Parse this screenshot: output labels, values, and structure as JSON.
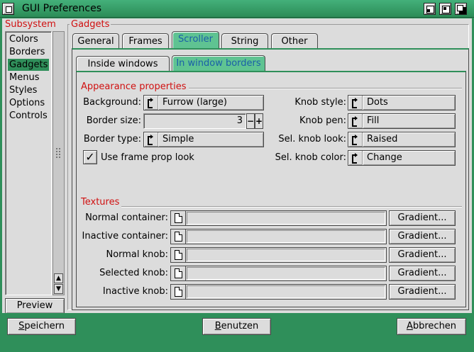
{
  "window": {
    "title": "GUI Preferences"
  },
  "subsystem": {
    "label": "Subsystem",
    "items": [
      "Colors",
      "Borders",
      "Gadgets",
      "Menus",
      "Styles",
      "Options",
      "Controls"
    ],
    "selected": "Gadgets",
    "preview_label": "Preview"
  },
  "gadgets": {
    "label": "Gadgets",
    "tabs": [
      "General",
      "Frames",
      "Scroller",
      "String",
      "Other"
    ],
    "active_tab": "Scroller",
    "subtabs": [
      "Inside windows",
      "In window borders"
    ],
    "active_subtab": "In window borders"
  },
  "appearance": {
    "title": "Appearance properties",
    "background_label": "Background:",
    "background_value": "Furrow (large)",
    "border_size_label": "Border size:",
    "border_size_value": "3",
    "minus": "−",
    "plus": "+",
    "border_type_label": "Border type:",
    "border_type_value": "Simple",
    "frame_prop_label": "Use frame prop look",
    "frame_prop_checked": "✓",
    "knob_style_label": "Knob style:",
    "knob_style_value": "Dots",
    "knob_pen_label": "Knob pen:",
    "knob_pen_value": "Fill",
    "sel_knob_look_label": "Sel. knob look:",
    "sel_knob_look_value": "Raised",
    "sel_knob_color_label": "Sel. knob color:",
    "sel_knob_color_value": "Change"
  },
  "textures": {
    "title": "Textures",
    "rows": [
      {
        "label": "Normal container:",
        "button": "Gradient..."
      },
      {
        "label": "Inactive container:",
        "button": "Gradient..."
      },
      {
        "label": "Normal knob:",
        "button": "Gradient..."
      },
      {
        "label": "Selected knob:",
        "button": "Gradient..."
      },
      {
        "label": "Inactive knob:",
        "button": "Gradient..."
      }
    ]
  },
  "bottom": {
    "save_first": "S",
    "save_rest": "peichern",
    "use_first": "B",
    "use_rest": "enutzen",
    "cancel_first": "A",
    "cancel_rest": "bbrechen"
  },
  "colors": {
    "accent": "#2f8f5a",
    "tab_active": "#5fc392",
    "label_red": "#d01010"
  }
}
